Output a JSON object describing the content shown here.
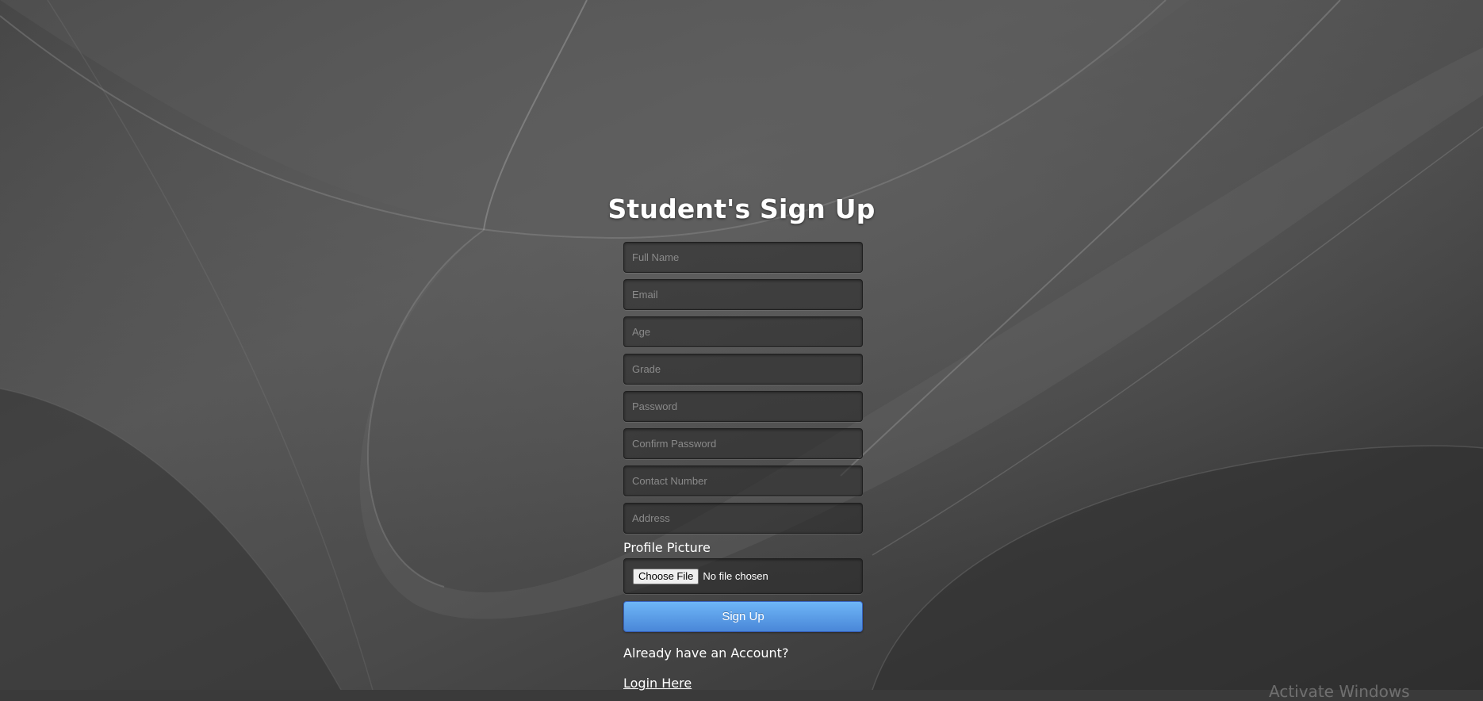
{
  "page": {
    "title": "Student's Sign Up"
  },
  "form": {
    "fields": [
      {
        "placeholder": "Full Name",
        "type": "text"
      },
      {
        "placeholder": "Email",
        "type": "email"
      },
      {
        "placeholder": "Age",
        "type": "text"
      },
      {
        "placeholder": "Grade",
        "type": "text"
      },
      {
        "placeholder": "Password",
        "type": "password"
      },
      {
        "placeholder": "Confirm Password",
        "type": "password"
      },
      {
        "placeholder": "Contact Number",
        "type": "text"
      },
      {
        "placeholder": "Address",
        "type": "text"
      }
    ],
    "profile_picture_label": "Profile Picture",
    "choose_file_label": "Choose File",
    "no_file_text": "No file chosen",
    "submit_label": "Sign Up"
  },
  "footer": {
    "already_text": "Already have an Account?",
    "login_link": "Login Here"
  },
  "watermark": {
    "text": "Activate Windows"
  },
  "colors": {
    "background": "#3a3a3a",
    "button_top": "#6eb6f7",
    "button_bottom": "#4a87d8",
    "text": "#ffffff"
  }
}
